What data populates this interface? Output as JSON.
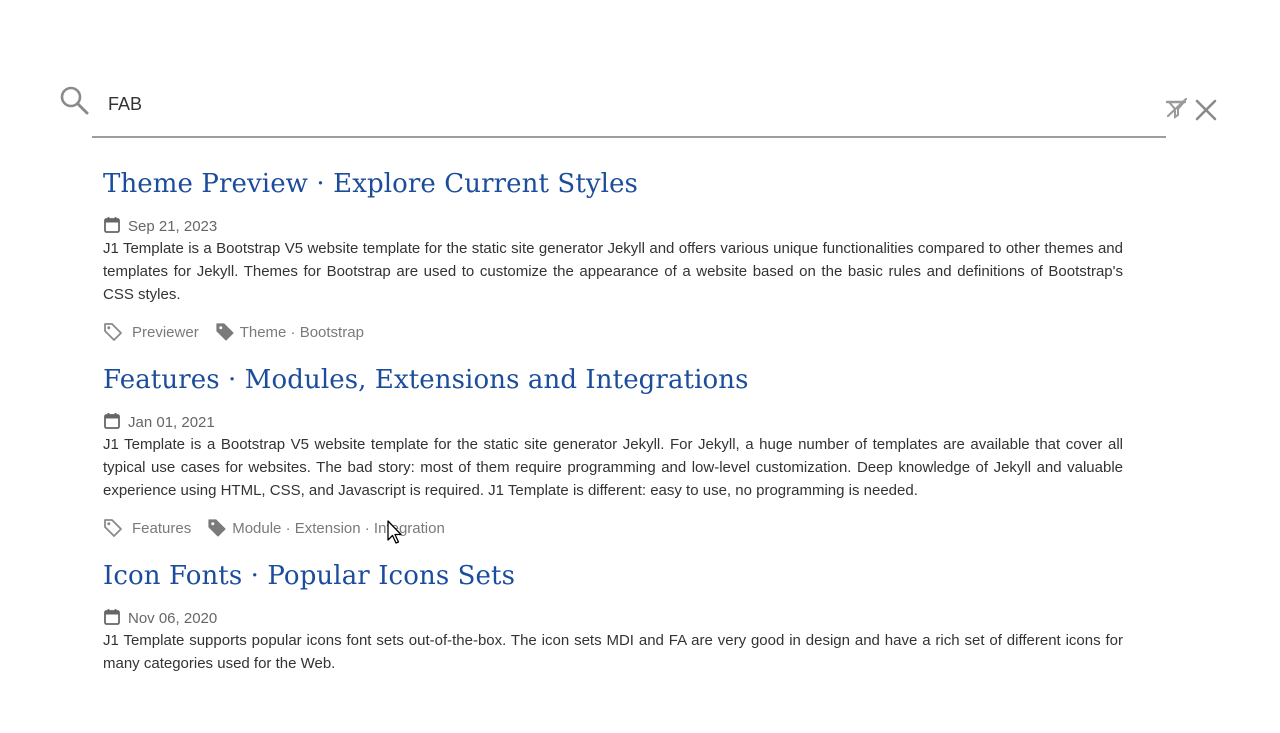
{
  "search": {
    "value": "FAB",
    "placeholder": ""
  },
  "icons": {
    "search": "search-icon",
    "filter_clear": "filter-remove-icon",
    "close": "close-icon",
    "calendar": "calendar-icon",
    "tag_outline": "tag-outline-icon",
    "tag_solid": "tag-icon"
  },
  "colors": {
    "title_link": "#1c4d9c",
    "muted_text": "#7a7a7a",
    "underline": "#9e9e9e"
  },
  "results": [
    {
      "title": "Theme Preview · Explore Current Styles",
      "date": "Sep 21, 2023",
      "description": "J1 Template is a Bootstrap V5 website template for the static site generator Jekyll and offers various unique functionalities compared to other themes and templates for Jekyll. Themes for Bootstrap are used to customize the appearance of a website based on the basic rules and definitions of Bootstrap's CSS styles.",
      "category": "Previewer",
      "tags": "Theme · Bootstrap"
    },
    {
      "title": "Features · Modules, Extensions and Integrations",
      "date": "Jan 01, 2021",
      "description": "J1 Template is a Bootstrap V5 website template for the static site generator Jekyll. For Jekyll, a huge number of templates are available that cover all typical use cases for websites. The bad story: most of them require programming and low-level customization. Deep knowledge of Jekyll and valuable experience using HTML, CSS, and Javascript is required. J1 Template is different: easy to use, no programming is needed.",
      "category": "Features",
      "tags": "Module · Extension · Integration"
    },
    {
      "title": "Icon Fonts · Popular Icons Sets",
      "date": "Nov 06, 2020",
      "description": "J1 Template supports popular icons font sets out-of-the-box. The icon sets MDI and FA are very good in design and have a rich set of different icons for many categories used for the Web."
    }
  ]
}
